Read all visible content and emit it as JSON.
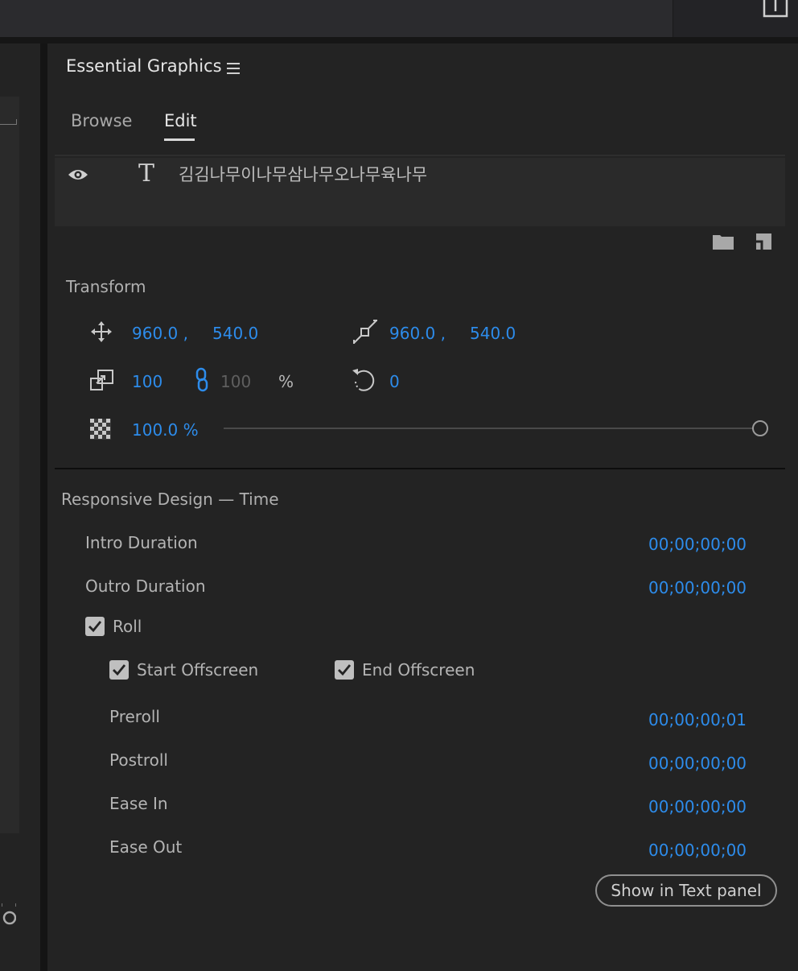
{
  "panel": {
    "title": "Essential Graphics",
    "tabs": [
      {
        "label": "Browse"
      },
      {
        "label": "Edit"
      }
    ],
    "active_tab": "Edit"
  },
  "layer": {
    "name": "김김나무이나무삼나무오나무육나무"
  },
  "transform": {
    "heading": "Transform",
    "position_x": "960.0 ,",
    "position_y": "540.0",
    "anchor_x": "960.0 ,",
    "anchor_y": "540.0",
    "scale": "100",
    "scale_height": "100",
    "scale_unit": "%",
    "rotation": "0",
    "opacity": "100.0 %",
    "opacity_level": 1.0
  },
  "responsive": {
    "heading": "Responsive Design — Time",
    "intro_label": "Intro Duration",
    "intro_value": "00;00;00;00",
    "outro_label": "Outro Duration",
    "outro_value": "00;00;00;00",
    "roll_label": "Roll",
    "start_offscreen_label": "Start Offscreen",
    "end_offscreen_label": "End Offscreen",
    "preroll_label": "Preroll",
    "preroll_value": "00;00;00;01",
    "postroll_label": "Postroll",
    "postroll_value": "00;00;00;00",
    "ease_in_label": "Ease In",
    "ease_in_value": "00;00;00;00",
    "ease_out_label": "Ease Out",
    "ease_out_value": "00;00;00;00",
    "show_button": "Show in Text panel"
  },
  "colors": {
    "accent": "#2d8ceb",
    "background": "#232323"
  }
}
